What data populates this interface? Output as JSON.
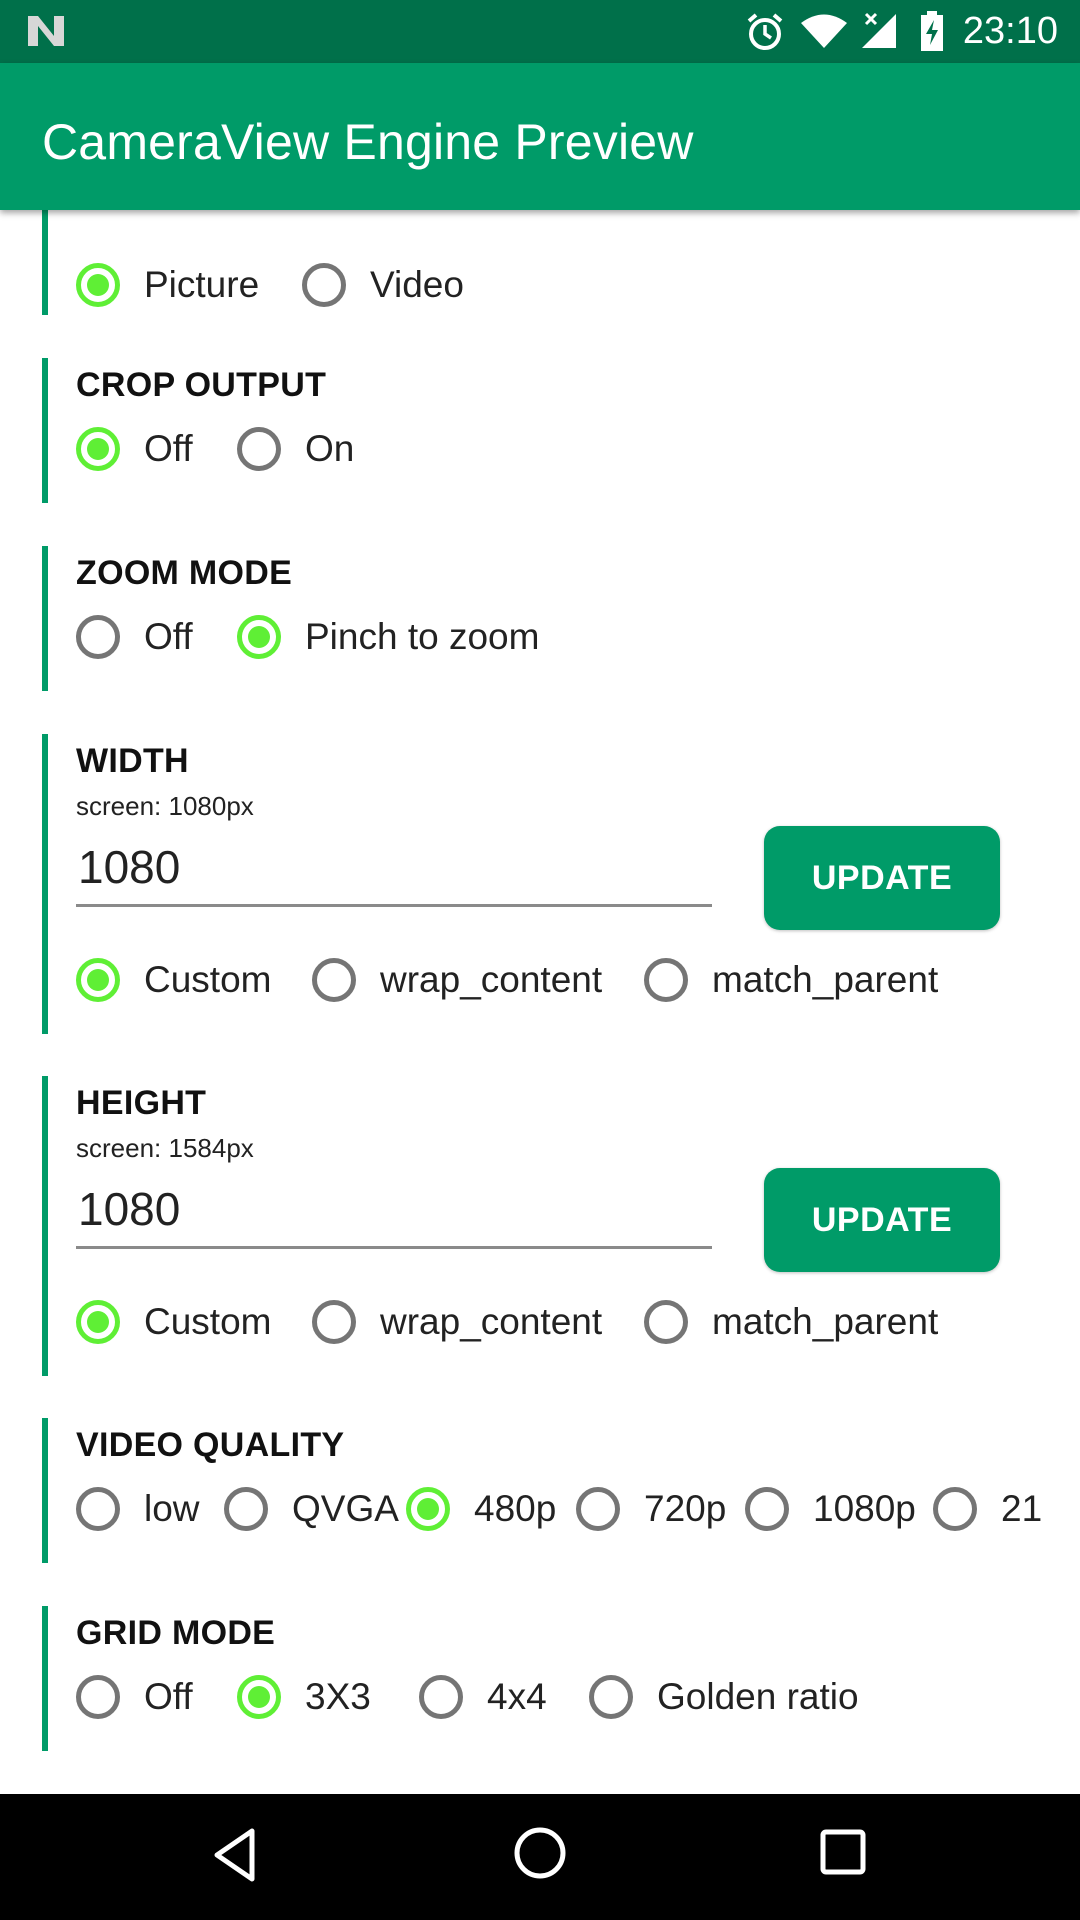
{
  "status_bar": {
    "time": "23:10",
    "icons": [
      "n-logo-icon",
      "alarm-icon",
      "wifi-icon",
      "signal-no-data-icon",
      "battery-charging-icon"
    ]
  },
  "app_bar": {
    "title": "CameraView Engine Preview"
  },
  "sections": {
    "mode": {
      "options": [
        "Picture",
        "Video"
      ],
      "selected": "Picture"
    },
    "crop_output": {
      "title": "CROP OUTPUT",
      "options": [
        "Off",
        "On"
      ],
      "selected": "Off"
    },
    "zoom_mode": {
      "title": "ZOOM MODE",
      "options": [
        "Off",
        "Pinch to zoom"
      ],
      "selected": "Pinch to zoom"
    },
    "width": {
      "title": "WIDTH",
      "subtitle": "screen: 1080px",
      "input_value": "1080",
      "button": "UPDATE",
      "options": [
        "Custom",
        "wrap_content",
        "match_parent"
      ],
      "selected": "Custom"
    },
    "height": {
      "title": "HEIGHT",
      "subtitle": "screen: 1584px",
      "input_value": "1080",
      "button": "UPDATE",
      "options": [
        "Custom",
        "wrap_content",
        "match_parent"
      ],
      "selected": "Custom"
    },
    "video_quality": {
      "title": "VIDEO QUALITY",
      "options": [
        "low",
        "QVGA",
        "480p",
        "720p",
        "1080p",
        "21"
      ],
      "selected": "480p"
    },
    "grid_mode": {
      "title": "GRID MODE",
      "options": [
        "Off",
        "3X3",
        "4x4",
        "Golden ratio"
      ],
      "selected": "3X3"
    }
  },
  "nav_bar": {
    "buttons": [
      "back-icon",
      "home-icon",
      "recents-icon"
    ]
  },
  "colors": {
    "status_bar": "#00704a",
    "primary": "#009b68",
    "radio_checked": "#5fef35",
    "radio_unchecked": "#757575"
  }
}
